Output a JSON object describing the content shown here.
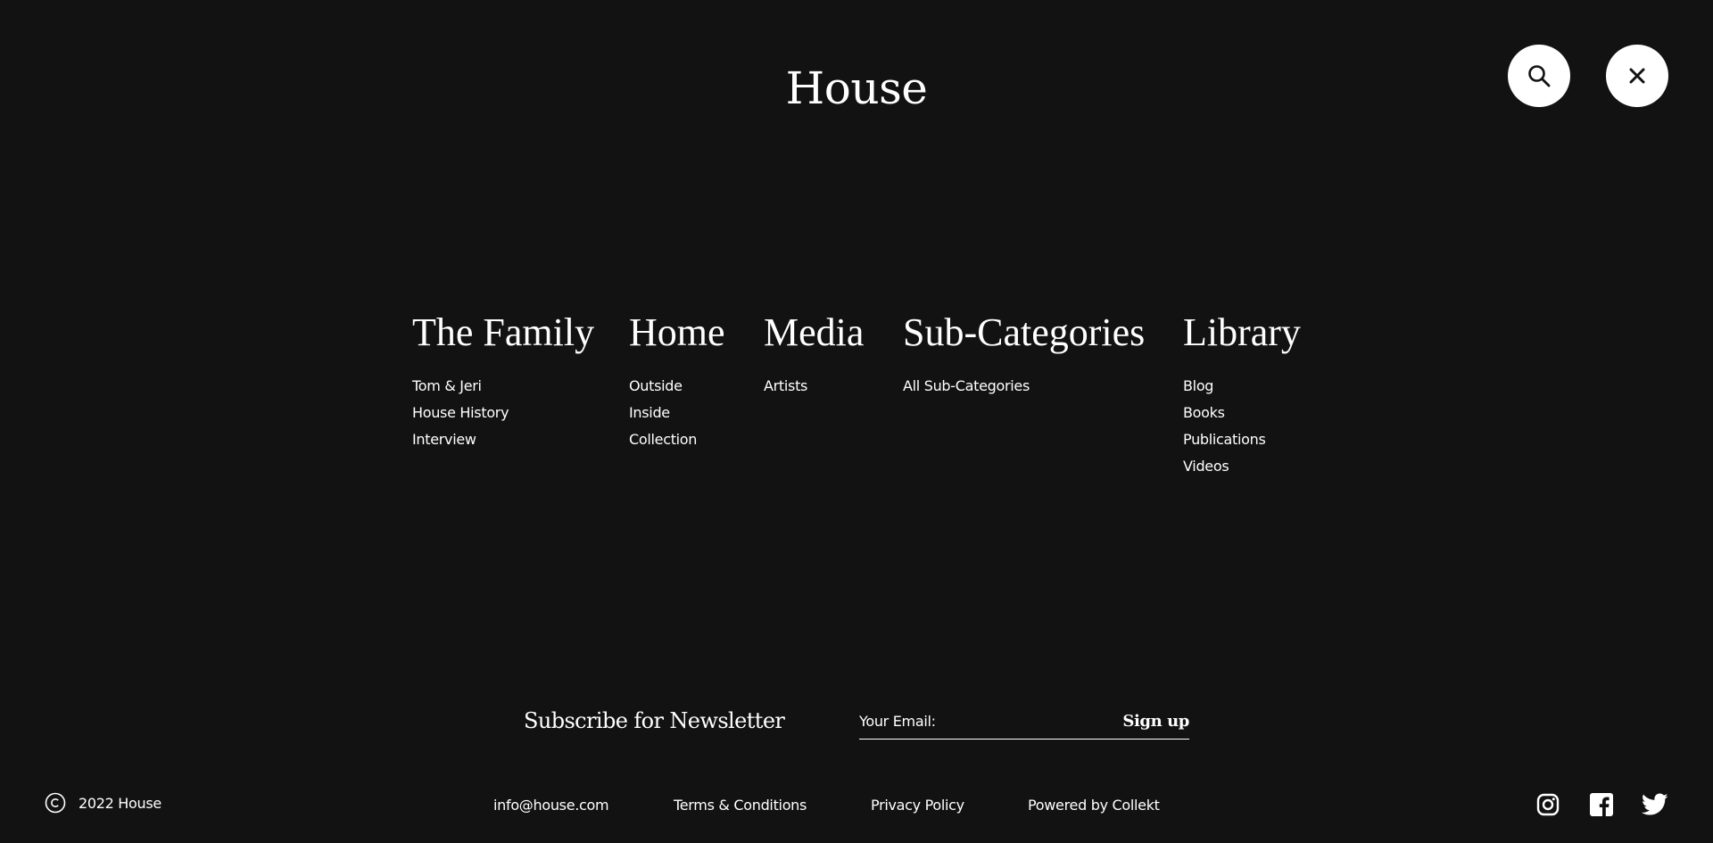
{
  "header": {
    "logo": "House",
    "search_icon": "search-icon",
    "close_icon": "close-icon"
  },
  "menu": {
    "columns": [
      {
        "heading": "The Family",
        "links": [
          "Tom & Jeri",
          "House History",
          "Interview"
        ]
      },
      {
        "heading": "Home",
        "links": [
          "Outside",
          "Inside",
          "Collection"
        ]
      },
      {
        "heading": "Media",
        "links": [
          "Artists"
        ]
      },
      {
        "heading": "Sub-Categories",
        "links": [
          "All Sub-Categories"
        ]
      },
      {
        "heading": "Library",
        "links": [
          "Blog",
          "Books",
          "Publications",
          "Videos"
        ]
      }
    ]
  },
  "newsletter": {
    "title": "Subscribe for Newsletter",
    "email_placeholder": "Your Email:",
    "email_value": "",
    "signup_label": "Sign up"
  },
  "footer": {
    "copyright_icon": "copyright-icon",
    "copyright_text": "2022 House",
    "email": "info@house.com",
    "terms": "Terms & Conditions",
    "privacy": "Privacy Policy",
    "powered": "Powered by Collekt",
    "social_icons": [
      "instagram-icon",
      "facebook-icon",
      "twitter-icon"
    ]
  },
  "colors": {
    "background": "#121212",
    "text": "#ffffff",
    "button_bg": "#ffffff",
    "button_icon": "#121212"
  }
}
